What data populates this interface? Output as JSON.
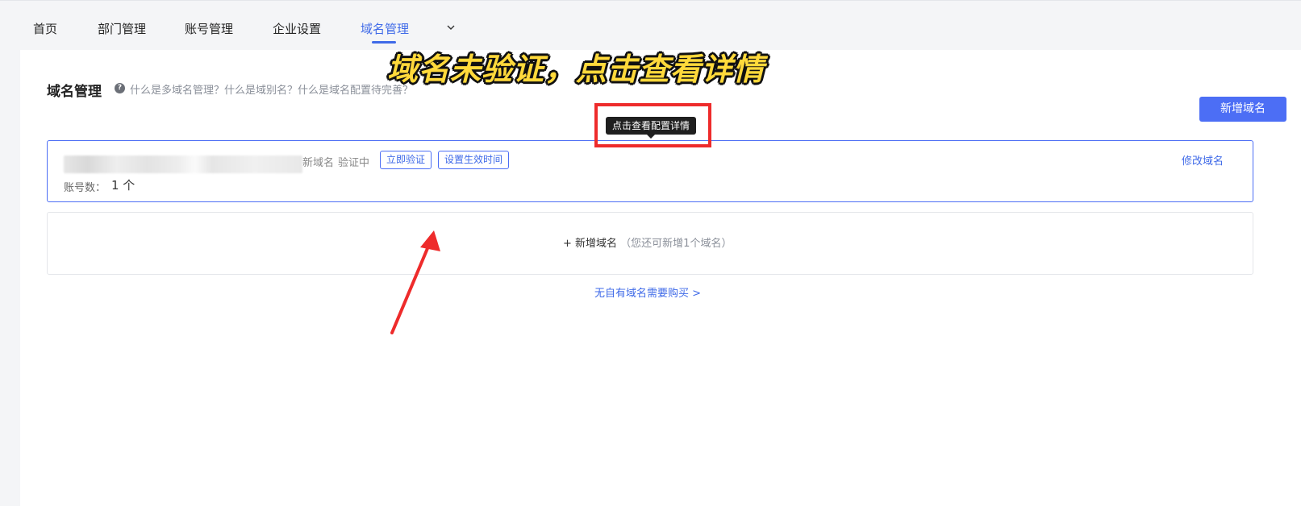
{
  "nav": {
    "items": [
      {
        "label": "首页"
      },
      {
        "label": "部门管理"
      },
      {
        "label": "账号管理"
      },
      {
        "label": "企业设置"
      },
      {
        "label": "域名管理"
      }
    ],
    "active_index": 4,
    "more_icon": "chevron-down-icon"
  },
  "page": {
    "title": "域名管理",
    "help_icon": "question-circle-icon",
    "help_text": "什么是多域名管理？什么是域别名？什么是域名配置待完善？",
    "add_button": "新增域名"
  },
  "annotation": {
    "overlay_text": "域名未验证，点击查看详情",
    "tooltip": "点击查看配置详情",
    "highlight_color": "#ee2b2b",
    "overlay_color": "#ffd93b"
  },
  "domain_card": {
    "type_label": "新域名",
    "status": "验证中",
    "verify_button": "立即验证",
    "schedule_button": "设置生效时间",
    "account_label": "账号数：",
    "account_count": "1 个",
    "edit_link": "修改域名"
  },
  "add_card": {
    "label": "+ 新增域名",
    "hint": "（您还可新增1个域名）"
  },
  "buy_link": "无自有域名需要购买 >",
  "colors": {
    "accent": "#3f6ae8",
    "primary_button": "#4c6ef5"
  }
}
